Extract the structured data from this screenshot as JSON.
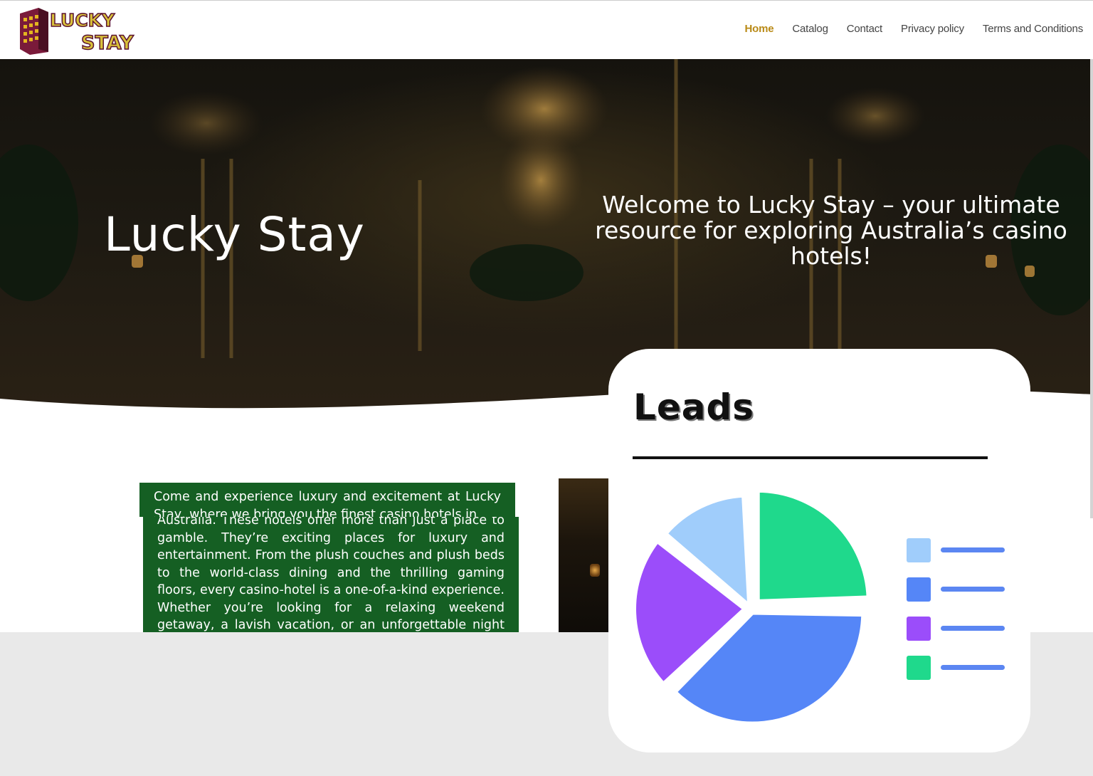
{
  "header": {
    "logo_text_line1": "LUCKY",
    "logo_text_line2": "STAY",
    "nav": [
      {
        "label": "Home",
        "active": true
      },
      {
        "label": "Catalog",
        "active": false
      },
      {
        "label": "Contact",
        "active": false
      },
      {
        "label": "Privacy policy",
        "active": false
      },
      {
        "label": "Terms and Conditions",
        "active": false
      }
    ]
  },
  "hero": {
    "title": "Lucky Stay",
    "subtitle": "Welcome to Lucky Stay – your ultimate resource for exploring Australia’s casino hotels!"
  },
  "content": {
    "paragraph_top": "Come and experience luxury and excitement at Lucky Stay, where we bring you the finest casino hotels in",
    "paragraph_main": "Australia. These hotels offer more than just a place to gamble. They’re exciting places for luxury and entertainment. From the plush couches and plush beds to the world-class dining and the thrilling gaming floors, every casino-hotel is a one-of-a-kind experience. Whether you’re looking for a relaxing weekend getaway, a lavish vacation, or an unforgettable night out, these establishments have something for everyone. Lucky Stay"
  },
  "card": {
    "title": "Leads"
  },
  "colors": {
    "accent_nav": "#b98a17",
    "text_box_green": "#155f23",
    "pie_light_blue": "#a0cdfb",
    "pie_blue": "#5586f7",
    "pie_purple": "#9b4dfa",
    "pie_green": "#1fd98c"
  },
  "chart_data": {
    "type": "pie",
    "title": "Leads",
    "values": [
      24,
      36,
      22,
      13
    ],
    "colors": [
      "#1fd98c",
      "#5586f7",
      "#9b4dfa",
      "#a0cdfb"
    ],
    "legend_colors": [
      "#a0cdfb",
      "#5586f7",
      "#9b4dfa",
      "#1fd98c"
    ],
    "legend": "right"
  }
}
